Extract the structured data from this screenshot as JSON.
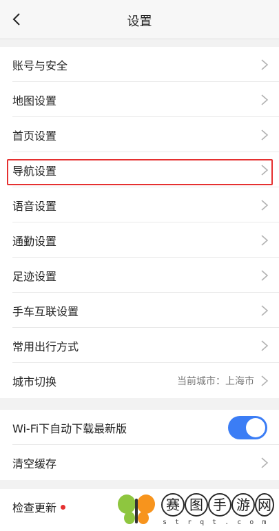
{
  "header": {
    "title": "设置"
  },
  "section1": [
    {
      "label": "账号与安全"
    },
    {
      "label": "地图设置"
    },
    {
      "label": "首页设置"
    },
    {
      "label": "导航设置"
    },
    {
      "label": "语音设置"
    },
    {
      "label": "通勤设置"
    },
    {
      "label": "足迹设置"
    },
    {
      "label": "手车互联设置"
    },
    {
      "label": "常用出行方式"
    },
    {
      "label": "城市切换",
      "value": "当前城市：上海市"
    }
  ],
  "section2": {
    "wifi_label": "Wi-Fi下自动下载最新版",
    "wifi_toggle_on": true,
    "clear_cache_label": "清空缓存"
  },
  "section3": {
    "check_update_label": "检查更新"
  },
  "watermark": {
    "chars": [
      "赛",
      "图",
      "手",
      "游",
      "网"
    ],
    "sub": "s t r q t . c o m"
  },
  "colors": {
    "accent": "#3b7df5",
    "highlight": "#e53030"
  }
}
